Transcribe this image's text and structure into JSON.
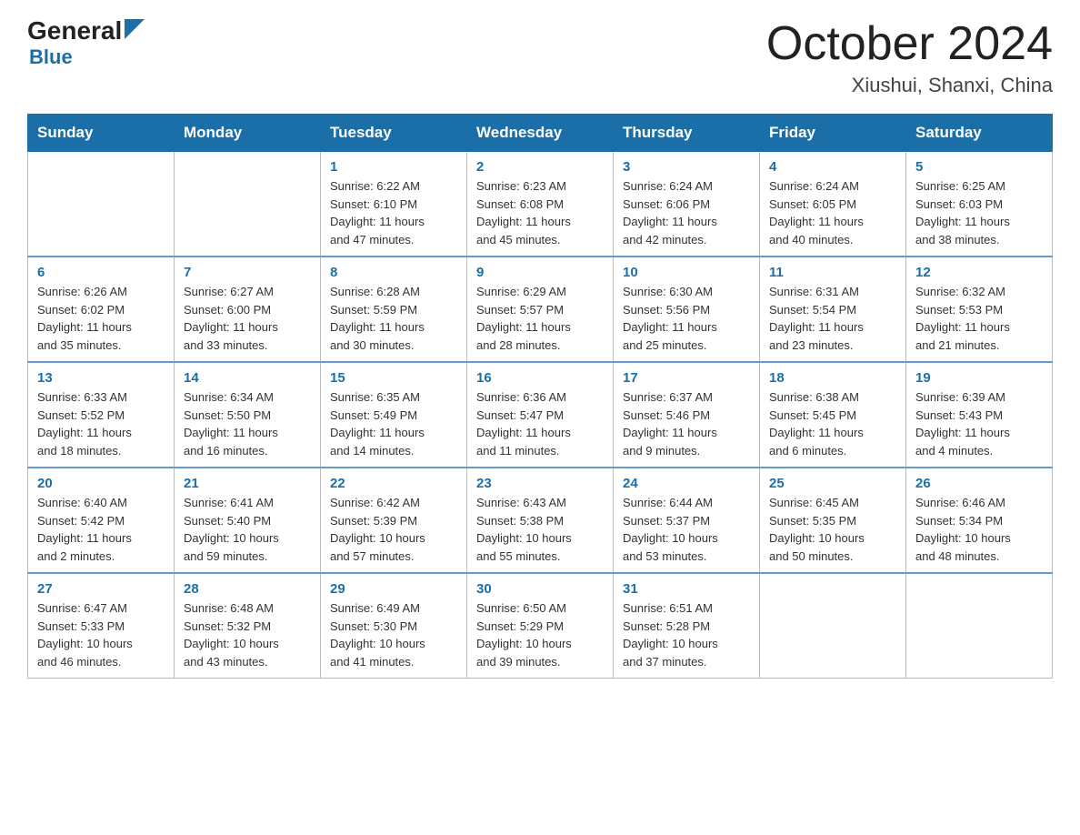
{
  "header": {
    "logo_general": "General",
    "logo_blue": "Blue",
    "title": "October 2024",
    "subtitle": "Xiushui, Shanxi, China"
  },
  "calendar": {
    "days_of_week": [
      "Sunday",
      "Monday",
      "Tuesday",
      "Wednesday",
      "Thursday",
      "Friday",
      "Saturday"
    ],
    "weeks": [
      [
        {
          "day": "",
          "info": ""
        },
        {
          "day": "",
          "info": ""
        },
        {
          "day": "1",
          "info": "Sunrise: 6:22 AM\nSunset: 6:10 PM\nDaylight: 11 hours\nand 47 minutes."
        },
        {
          "day": "2",
          "info": "Sunrise: 6:23 AM\nSunset: 6:08 PM\nDaylight: 11 hours\nand 45 minutes."
        },
        {
          "day": "3",
          "info": "Sunrise: 6:24 AM\nSunset: 6:06 PM\nDaylight: 11 hours\nand 42 minutes."
        },
        {
          "day": "4",
          "info": "Sunrise: 6:24 AM\nSunset: 6:05 PM\nDaylight: 11 hours\nand 40 minutes."
        },
        {
          "day": "5",
          "info": "Sunrise: 6:25 AM\nSunset: 6:03 PM\nDaylight: 11 hours\nand 38 minutes."
        }
      ],
      [
        {
          "day": "6",
          "info": "Sunrise: 6:26 AM\nSunset: 6:02 PM\nDaylight: 11 hours\nand 35 minutes."
        },
        {
          "day": "7",
          "info": "Sunrise: 6:27 AM\nSunset: 6:00 PM\nDaylight: 11 hours\nand 33 minutes."
        },
        {
          "day": "8",
          "info": "Sunrise: 6:28 AM\nSunset: 5:59 PM\nDaylight: 11 hours\nand 30 minutes."
        },
        {
          "day": "9",
          "info": "Sunrise: 6:29 AM\nSunset: 5:57 PM\nDaylight: 11 hours\nand 28 minutes."
        },
        {
          "day": "10",
          "info": "Sunrise: 6:30 AM\nSunset: 5:56 PM\nDaylight: 11 hours\nand 25 minutes."
        },
        {
          "day": "11",
          "info": "Sunrise: 6:31 AM\nSunset: 5:54 PM\nDaylight: 11 hours\nand 23 minutes."
        },
        {
          "day": "12",
          "info": "Sunrise: 6:32 AM\nSunset: 5:53 PM\nDaylight: 11 hours\nand 21 minutes."
        }
      ],
      [
        {
          "day": "13",
          "info": "Sunrise: 6:33 AM\nSunset: 5:52 PM\nDaylight: 11 hours\nand 18 minutes."
        },
        {
          "day": "14",
          "info": "Sunrise: 6:34 AM\nSunset: 5:50 PM\nDaylight: 11 hours\nand 16 minutes."
        },
        {
          "day": "15",
          "info": "Sunrise: 6:35 AM\nSunset: 5:49 PM\nDaylight: 11 hours\nand 14 minutes."
        },
        {
          "day": "16",
          "info": "Sunrise: 6:36 AM\nSunset: 5:47 PM\nDaylight: 11 hours\nand 11 minutes."
        },
        {
          "day": "17",
          "info": "Sunrise: 6:37 AM\nSunset: 5:46 PM\nDaylight: 11 hours\nand 9 minutes."
        },
        {
          "day": "18",
          "info": "Sunrise: 6:38 AM\nSunset: 5:45 PM\nDaylight: 11 hours\nand 6 minutes."
        },
        {
          "day": "19",
          "info": "Sunrise: 6:39 AM\nSunset: 5:43 PM\nDaylight: 11 hours\nand 4 minutes."
        }
      ],
      [
        {
          "day": "20",
          "info": "Sunrise: 6:40 AM\nSunset: 5:42 PM\nDaylight: 11 hours\nand 2 minutes."
        },
        {
          "day": "21",
          "info": "Sunrise: 6:41 AM\nSunset: 5:40 PM\nDaylight: 10 hours\nand 59 minutes."
        },
        {
          "day": "22",
          "info": "Sunrise: 6:42 AM\nSunset: 5:39 PM\nDaylight: 10 hours\nand 57 minutes."
        },
        {
          "day": "23",
          "info": "Sunrise: 6:43 AM\nSunset: 5:38 PM\nDaylight: 10 hours\nand 55 minutes."
        },
        {
          "day": "24",
          "info": "Sunrise: 6:44 AM\nSunset: 5:37 PM\nDaylight: 10 hours\nand 53 minutes."
        },
        {
          "day": "25",
          "info": "Sunrise: 6:45 AM\nSunset: 5:35 PM\nDaylight: 10 hours\nand 50 minutes."
        },
        {
          "day": "26",
          "info": "Sunrise: 6:46 AM\nSunset: 5:34 PM\nDaylight: 10 hours\nand 48 minutes."
        }
      ],
      [
        {
          "day": "27",
          "info": "Sunrise: 6:47 AM\nSunset: 5:33 PM\nDaylight: 10 hours\nand 46 minutes."
        },
        {
          "day": "28",
          "info": "Sunrise: 6:48 AM\nSunset: 5:32 PM\nDaylight: 10 hours\nand 43 minutes."
        },
        {
          "day": "29",
          "info": "Sunrise: 6:49 AM\nSunset: 5:30 PM\nDaylight: 10 hours\nand 41 minutes."
        },
        {
          "day": "30",
          "info": "Sunrise: 6:50 AM\nSunset: 5:29 PM\nDaylight: 10 hours\nand 39 minutes."
        },
        {
          "day": "31",
          "info": "Sunrise: 6:51 AM\nSunset: 5:28 PM\nDaylight: 10 hours\nand 37 minutes."
        },
        {
          "day": "",
          "info": ""
        },
        {
          "day": "",
          "info": ""
        }
      ]
    ]
  }
}
